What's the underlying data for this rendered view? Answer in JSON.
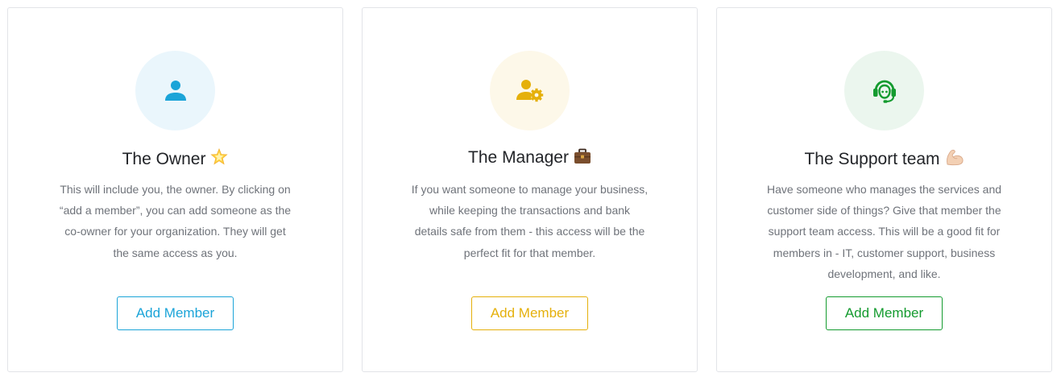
{
  "colors": {
    "owner_accent": "#1ba4d8",
    "manager_accent": "#e5b00b",
    "support_accent": "#149b2f",
    "text_dark": "#222428",
    "text_muted": "#6f737a",
    "border": "#e2e4e8"
  },
  "cards": [
    {
      "icon": "user-icon",
      "title": "The Owner",
      "emoji": "star-emoji",
      "description": [
        "This will include you, the owner. By clicking on",
        "“add a member”, you can add someone as the",
        "co-owner for your organization. They will get",
        "the same access as you."
      ],
      "button_label": "Add Member"
    },
    {
      "icon": "user-gear-icon",
      "title": "The Manager",
      "emoji": "briefcase-emoji",
      "description": [
        "If you want someone to manage your business,",
        "while keeping the transactions and bank",
        "details safe from them - this access will be the",
        "perfect fit for that member."
      ],
      "button_label": "Add Member"
    },
    {
      "icon": "headset-icon",
      "title": "The Support team",
      "emoji": "flexed-biceps-emoji",
      "description": [
        "Have someone who manages the services and",
        "customer side of things? Give that member the",
        "support team access. This will be a good fit for",
        "members in - IT, customer support, business",
        "development, and like."
      ],
      "button_label": "Add Member"
    }
  ]
}
